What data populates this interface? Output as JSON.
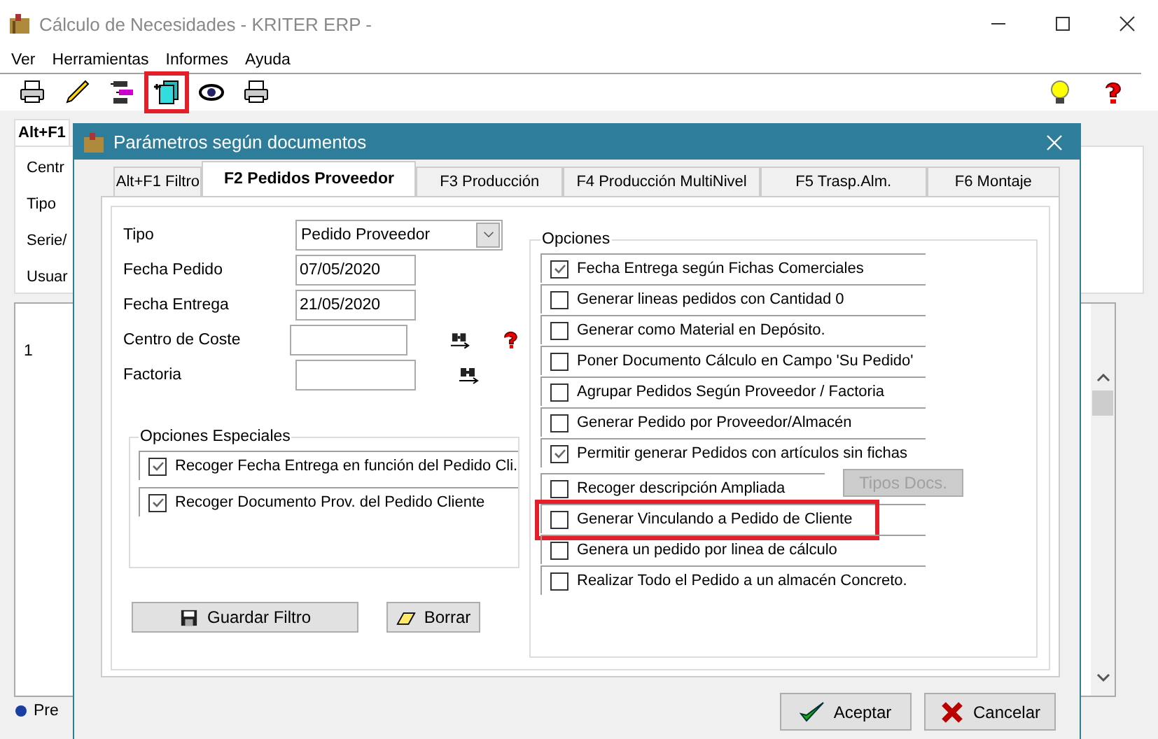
{
  "window": {
    "title": "Cálculo de Necesidades - KRITER ERP -"
  },
  "menu": [
    "Ver",
    "Herramientas",
    "Informes",
    "Ayuda"
  ],
  "toolbar": [
    {
      "kind": "printer",
      "highlighted": false
    },
    {
      "kind": "pencil",
      "highlighted": false
    },
    {
      "kind": "tree",
      "highlighted": false
    },
    {
      "kind": "documents",
      "highlighted": true
    },
    {
      "kind": "eye",
      "highlighted": false
    },
    {
      "kind": "printer",
      "highlighted": false
    }
  ],
  "toolbar_right": [
    {
      "kind": "bulb"
    },
    {
      "kind": "help"
    }
  ],
  "main": {
    "tab": "Alt+F1",
    "fields": [
      "Centr",
      "Tipo",
      "Serie/",
      "Usuar"
    ],
    "grid_row": "1",
    "footer": "Pre"
  },
  "dialog": {
    "title": "Parámetros según documentos",
    "tabs": [
      {
        "label": "Alt+F1 Filtro",
        "selected": false
      },
      {
        "label": "F2 Pedidos Proveedor",
        "selected": true
      },
      {
        "label": "F3 Producción",
        "selected": false
      },
      {
        "label": "F4 Producción MultiNivel",
        "selected": false
      },
      {
        "label": "F5 Trasp.Alm.",
        "selected": false
      },
      {
        "label": "F6 Montaje",
        "selected": false
      }
    ],
    "fields": [
      {
        "kind": "select",
        "label": "Tipo",
        "value": "Pedido Proveedor"
      },
      {
        "kind": "text",
        "label": "Fecha Pedido",
        "value": "07/05/2020"
      },
      {
        "kind": "text",
        "label": "Fecha Entrega",
        "value": "21/05/2020"
      },
      {
        "kind": "lookup",
        "label": "Centro de Coste",
        "help": true
      },
      {
        "kind": "lookup",
        "label": "Factoria",
        "help": false
      }
    ],
    "special_options": {
      "title": "Opciones Especiales",
      "items": [
        {
          "label": "Recoger Fecha Entrega en función del Pedido Cli.",
          "checked": true
        },
        {
          "label": "Recoger Documento Prov. del Pedido Cliente",
          "checked": true
        }
      ]
    },
    "filter_buttons": [
      {
        "kind": "save",
        "label": "Guardar Filtro"
      },
      {
        "kind": "erase",
        "label": "Borrar"
      }
    ],
    "options": {
      "title": "Opciones",
      "items": [
        {
          "label": "Fecha Entrega según Fichas Comerciales",
          "checked": true,
          "highlighted": false
        },
        {
          "label": "Generar lineas pedidos con Cantidad 0",
          "checked": false,
          "highlighted": false
        },
        {
          "label": "Generar como Material en Depósito.",
          "checked": false,
          "highlighted": false
        },
        {
          "label": "Poner Documento Cálculo en Campo 'Su Pedido'",
          "checked": false,
          "highlighted": false
        },
        {
          "label": "Agrupar Pedidos Según Proveedor / Factoria",
          "checked": false,
          "highlighted": false
        },
        {
          "label": "Generar Pedido por Proveedor/Almacén",
          "checked": false,
          "highlighted": false
        },
        {
          "label": "Permitir generar Pedidos con artículos sin fichas",
          "checked": true,
          "highlighted": false
        },
        {
          "label": "Recoger descripción Ampliada",
          "checked": false,
          "highlighted": false,
          "button": {
            "label": "Tipos Docs.",
            "disabled": true
          }
        },
        {
          "label": "Generar Vinculando a Pedido de Cliente",
          "checked": false,
          "highlighted": true
        },
        {
          "label": "Genera un pedido por linea de cálculo",
          "checked": false,
          "highlighted": false
        },
        {
          "label": "Realizar Todo el Pedido a un almacén Concreto.",
          "checked": false,
          "highlighted": false
        }
      ]
    },
    "buttons": [
      {
        "kind": "accept",
        "label": "Aceptar"
      },
      {
        "kind": "cancel",
        "label": "Cancelar"
      }
    ]
  }
}
